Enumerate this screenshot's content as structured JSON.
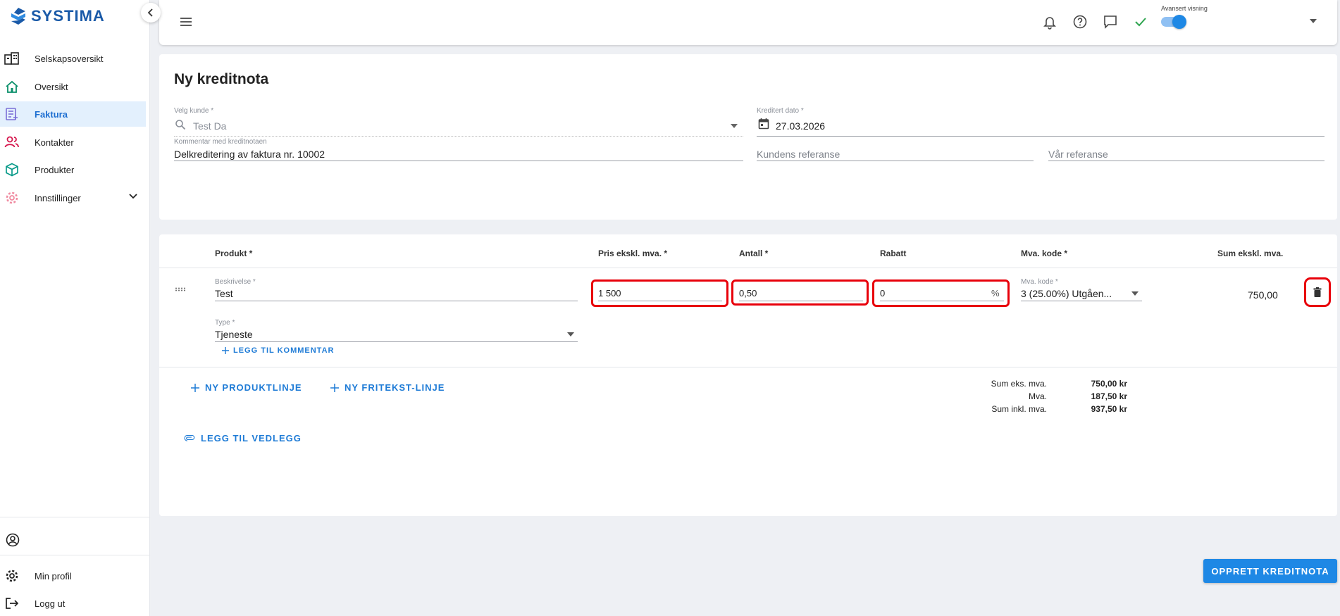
{
  "app": {
    "logo_text": "SYSTIMA"
  },
  "sidebar": {
    "items": [
      {
        "label": "Selskapsoversikt",
        "icon": "building-icon"
      },
      {
        "label": "Oversikt",
        "icon": "home-icon"
      },
      {
        "label": "Faktura",
        "icon": "invoice-icon",
        "active": true
      },
      {
        "label": "Kontakter",
        "icon": "contacts-icon"
      },
      {
        "label": "Produkter",
        "icon": "cube-icon"
      },
      {
        "label": "Innstillinger",
        "icon": "gear-icon"
      }
    ],
    "bottom": [
      {
        "label": "Min profil",
        "icon": "gear-icon"
      },
      {
        "label": "Logg ut",
        "icon": "logout-icon"
      }
    ]
  },
  "header": {
    "advanced_view_label": "Avansert visning",
    "advanced_view_on": true
  },
  "form": {
    "title": "Ny kreditnota",
    "customer": {
      "label": "Velg kunde *",
      "value": "Test Da"
    },
    "credit_date": {
      "label": "Kreditert dato *",
      "value": "27.03.2026"
    },
    "comment": {
      "label": "Kommentar med kreditnotaen",
      "value": "Delkreditering av faktura nr. 10002"
    },
    "customer_ref": {
      "placeholder": "Kundens referanse"
    },
    "our_ref": {
      "placeholder": "Vår referanse"
    }
  },
  "lines": {
    "headers": {
      "product": "Produkt *",
      "price": "Pris ekskl. mva. *",
      "qty": "Antall *",
      "discount": "Rabatt",
      "vat_code": "Mva. kode *",
      "sum": "Sum ekskl. mva."
    },
    "row": {
      "description_label": "Beskrivelse *",
      "description": "Test",
      "price": "1 500",
      "qty": "0,50",
      "discount": "0",
      "discount_unit": "%",
      "vat_label": "Mva. kode *",
      "vat_value": "3 (25.00%) Utgåen...",
      "type_label": "Type *",
      "type_value": "Tjeneste",
      "add_comment": "LEGG TIL KOMMENTAR",
      "sum": "750,00"
    },
    "add_product_line": "NY PRODUKTLINJE",
    "add_freetext_line": "NY FRITEKST-LINJE",
    "add_attachment": "LEGG TIL VEDLEGG"
  },
  "totals": {
    "rows": [
      {
        "label": "Sum eks. mva.",
        "value": "750,00 kr"
      },
      {
        "label": "Mva.",
        "value": "187,50 kr"
      },
      {
        "label": "Sum inkl. mva.",
        "value": "937,50 kr"
      }
    ]
  },
  "actions": {
    "create": "OPPRETT KREDITNOTA"
  },
  "colors": {
    "accent": "#1e88e5",
    "highlight": "#e8000a",
    "active_bg": "#e3f0fd"
  }
}
